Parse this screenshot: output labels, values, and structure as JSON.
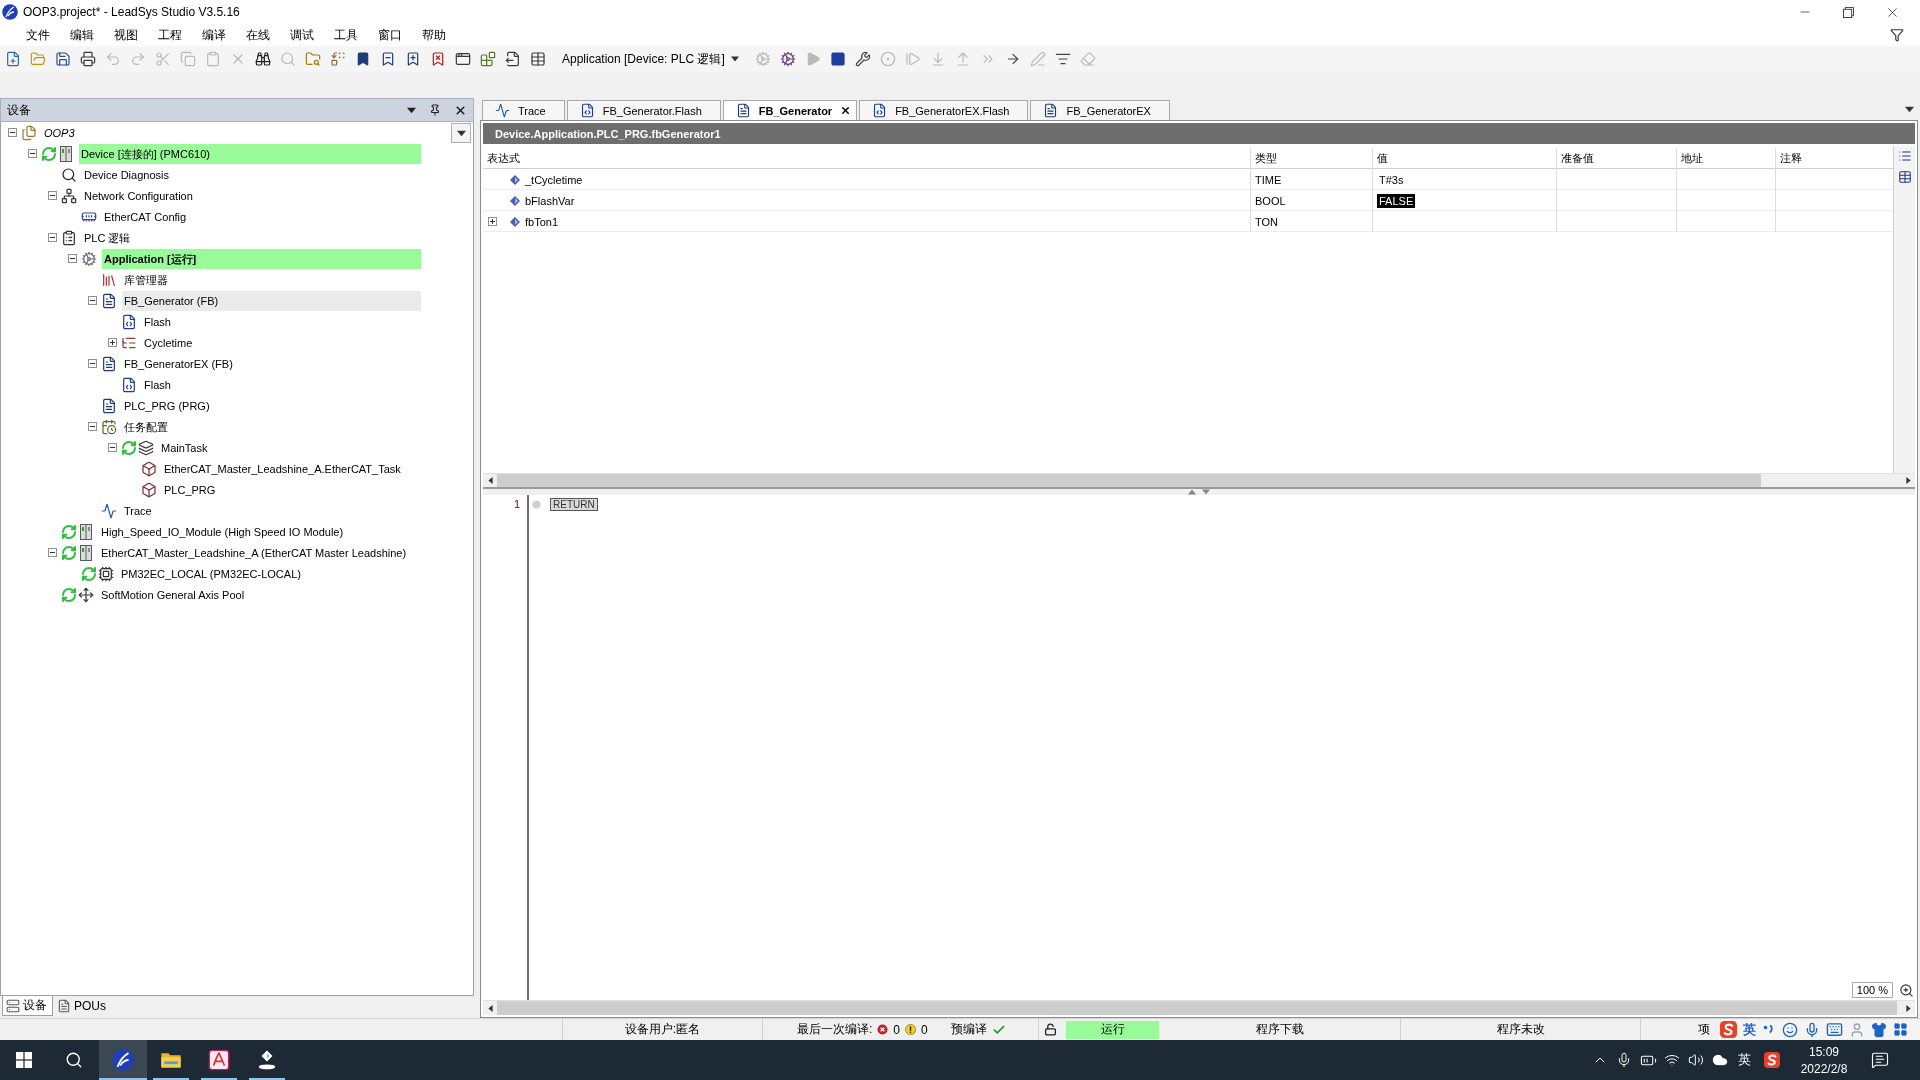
{
  "window": {
    "title": "OOP3.project* - LeadSys Studio V3.5.16"
  },
  "menu": [
    "文件",
    "编辑",
    "视图",
    "工程",
    "编译",
    "在线",
    "调试",
    "工具",
    "窗口",
    "帮助"
  ],
  "toolbar": [
    {
      "kind": "new",
      "disabled": false
    },
    {
      "kind": "open",
      "disabled": false
    },
    {
      "kind": "save",
      "disabled": false
    },
    {
      "kind": "print",
      "disabled": false
    },
    {
      "kind": "undo",
      "disabled": true
    },
    {
      "kind": "redo",
      "disabled": true
    },
    {
      "kind": "cut",
      "disabled": true
    },
    {
      "kind": "copy",
      "disabled": true
    },
    {
      "kind": "paste",
      "disabled": true
    },
    {
      "kind": "delete",
      "disabled": true
    },
    {
      "kind": "find",
      "disabled": false
    },
    {
      "kind": "find-next",
      "disabled": true
    },
    {
      "kind": "find-project",
      "disabled": false
    },
    {
      "kind": "replace",
      "disabled": false
    },
    {
      "kind": "bookmark",
      "disabled": false
    },
    {
      "kind": "bookmark-prev",
      "disabled": false
    },
    {
      "kind": "bookmark-next",
      "disabled": false
    },
    {
      "kind": "bookmark-clear",
      "disabled": false
    },
    {
      "kind": "window",
      "disabled": false
    },
    {
      "kind": "build",
      "disabled": false
    },
    {
      "kind": "export",
      "disabled": false
    },
    {
      "kind": "grid",
      "disabled": false
    },
    {
      "kind": "select",
      "label": "Application [Device: PLC 逻辑]",
      "disabled": false
    },
    {
      "kind": "login",
      "disabled": true
    },
    {
      "kind": "logout",
      "disabled": false
    },
    {
      "kind": "start",
      "disabled": true
    },
    {
      "kind": "stop",
      "disabled": false
    },
    {
      "kind": "reset",
      "disabled": false
    },
    {
      "kind": "breakpoint",
      "disabled": true
    },
    {
      "kind": "step-over",
      "disabled": true
    },
    {
      "kind": "step-into",
      "disabled": true
    },
    {
      "kind": "step-out",
      "disabled": true
    },
    {
      "kind": "run-to",
      "disabled": true
    },
    {
      "kind": "next-statement",
      "disabled": false
    },
    {
      "kind": "write",
      "disabled": true
    },
    {
      "kind": "force",
      "disabled": false
    },
    {
      "kind": "unforce",
      "disabled": true
    }
  ],
  "devices_panel": {
    "title": "设备",
    "tree": [
      {
        "label": "OOP3",
        "kind": "project",
        "online": false,
        "highlighted": false,
        "active": false,
        "selected": false,
        "expanded": true,
        "children": [
          {
            "label": "Device [连接的] (PMC610)",
            "kind": "device",
            "online": true,
            "highlighted": true,
            "active": false,
            "selected": false,
            "expanded": true,
            "children": [
              {
                "label": "Device Diagnosis",
                "kind": "diagnosis",
                "online": false,
                "highlighted": false,
                "active": false,
                "selected": false
              },
              {
                "label": "Network Configuration",
                "kind": "network",
                "online": false,
                "highlighted": false,
                "active": false,
                "selected": false,
                "expanded": true,
                "children": [
                  {
                    "label": "EtherCAT Config",
                    "kind": "ethercat",
                    "online": false,
                    "highlighted": false,
                    "active": false,
                    "selected": false
                  }
                ]
              },
              {
                "label": "PLC 逻辑",
                "kind": "plc",
                "online": false,
                "highlighted": false,
                "active": false,
                "selected": false,
                "expanded": true,
                "children": [
                  {
                    "label": "Application [运行]",
                    "kind": "application",
                    "online": false,
                    "highlighted": true,
                    "active": true,
                    "selected": false,
                    "expanded": true,
                    "children": [
                      {
                        "label": "库管理器",
                        "kind": "library",
                        "online": false,
                        "highlighted": false,
                        "active": false,
                        "selected": false
                      },
                      {
                        "label": "FB_Generator (FB)",
                        "kind": "pou",
                        "online": false,
                        "highlighted": false,
                        "active": false,
                        "selected": true,
                        "expanded": true,
                        "children": [
                          {
                            "label": "Flash",
                            "kind": "method",
                            "online": false,
                            "highlighted": false,
                            "active": false,
                            "selected": false
                          },
                          {
                            "label": "Cycletime",
                            "kind": "property",
                            "online": false,
                            "highlighted": false,
                            "active": false,
                            "selected": false,
                            "expanded": false
                          }
                        ]
                      },
                      {
                        "label": "FB_GeneratorEX (FB)",
                        "kind": "pou",
                        "online": false,
                        "highlighted": false,
                        "active": false,
                        "selected": false,
                        "expanded": true,
                        "children": [
                          {
                            "label": "Flash",
                            "kind": "method",
                            "online": false,
                            "highlighted": false,
                            "active": false,
                            "selected": false
                          }
                        ]
                      },
                      {
                        "label": "PLC_PRG (PRG)",
                        "kind": "pou",
                        "online": false,
                        "highlighted": false,
                        "active": false,
                        "selected": false
                      },
                      {
                        "label": "任务配置",
                        "kind": "task-config",
                        "online": false,
                        "highlighted": false,
                        "active": false,
                        "selected": false,
                        "expanded": true,
                        "children": [
                          {
                            "label": "MainTask",
                            "kind": "task",
                            "online": true,
                            "highlighted": false,
                            "active": false,
                            "selected": false,
                            "expanded": true,
                            "children": [
                              {
                                "label": "EtherCAT_Master_Leadshine_A.EtherCAT_Task",
                                "kind": "task-call",
                                "online": false,
                                "highlighted": false,
                                "active": false,
                                "selected": false
                              },
                              {
                                "label": "PLC_PRG",
                                "kind": "task-call",
                                "online": false,
                                "highlighted": false,
                                "active": false,
                                "selected": false
                              }
                            ]
                          }
                        ]
                      },
                      {
                        "label": "Trace",
                        "kind": "trace",
                        "online": false,
                        "highlighted": false,
                        "active": false,
                        "selected": false
                      }
                    ]
                  }
                ]
              },
              {
                "label": "High_Speed_IO_Module (High Speed IO Module)",
                "kind": "device",
                "online": true,
                "highlighted": false,
                "active": false,
                "selected": false
              },
              {
                "label": "EtherCAT_Master_Leadshine_A (EtherCAT Master Leadshine)",
                "kind": "device",
                "online": true,
                "highlighted": false,
                "active": false,
                "selected": false,
                "expanded": true,
                "children": [
                  {
                    "label": "PM32EC_LOCAL (PM32EC-LOCAL)",
                    "kind": "drive",
                    "online": true,
                    "highlighted": false,
                    "active": false,
                    "selected": false
                  }
                ]
              },
              {
                "label": "SoftMotion General Axis Pool",
                "kind": "axis-pool",
                "online": true,
                "highlighted": false,
                "active": false,
                "selected": false
              }
            ]
          }
        ]
      }
    ],
    "tabs": [
      {
        "label": "设备",
        "kind": "devices",
        "selected": true
      },
      {
        "label": "POUs",
        "kind": "pous",
        "selected": false
      }
    ]
  },
  "editor_tabs": [
    {
      "label": "Trace",
      "kind": "trace",
      "selected": false
    },
    {
      "label": "FB_Generator.Flash",
      "kind": "method",
      "selected": false
    },
    {
      "label": "FB_Generator",
      "kind": "pou",
      "selected": true
    },
    {
      "label": "FB_GeneratorEX.Flash",
      "kind": "method",
      "selected": false
    },
    {
      "label": "FB_GeneratorEX",
      "kind": "pou",
      "selected": false
    }
  ],
  "monitor": {
    "path": "Device.Application.PLC_PRG.fbGenerator1",
    "columns": [
      "表达式",
      "类型",
      "值",
      "准备值",
      "地址",
      "注释"
    ],
    "rows": [
      {
        "expression": "_tCycletime",
        "type": "TIME",
        "value": "T#3s",
        "changed": false
      },
      {
        "expression": "bFlashVar",
        "type": "BOOL",
        "value": "FALSE",
        "changed": true
      },
      {
        "expression": "fbTon1",
        "type": "TON",
        "expanded": false
      }
    ]
  },
  "code": {
    "lines": [
      {
        "number": "1",
        "code": "RETURN",
        "breakpoint": false
      }
    ],
    "zoom": "100 %"
  },
  "status_bar": {
    "user": "设备用户:匿名",
    "last_build": "最后一次编译:",
    "errors": "0",
    "warnings": "0",
    "precompile": "预编译",
    "precompile_ok": true,
    "locked": false,
    "run_state": "运行",
    "running": true,
    "download": "程序下载",
    "changes": "程序未改",
    "project": "项"
  },
  "ime_bar": {
    "mode": "英"
  },
  "taskbar": {
    "apps": [
      {
        "kind": "leadsys",
        "active": true,
        "running": true
      },
      {
        "kind": "explorer",
        "active": false,
        "running": true
      },
      {
        "kind": "pdf",
        "active": false,
        "running": true
      },
      {
        "kind": "installer",
        "active": false,
        "running": true
      }
    ],
    "input_language": "英",
    "time": "15:09",
    "date": "2022/2/8"
  }
}
